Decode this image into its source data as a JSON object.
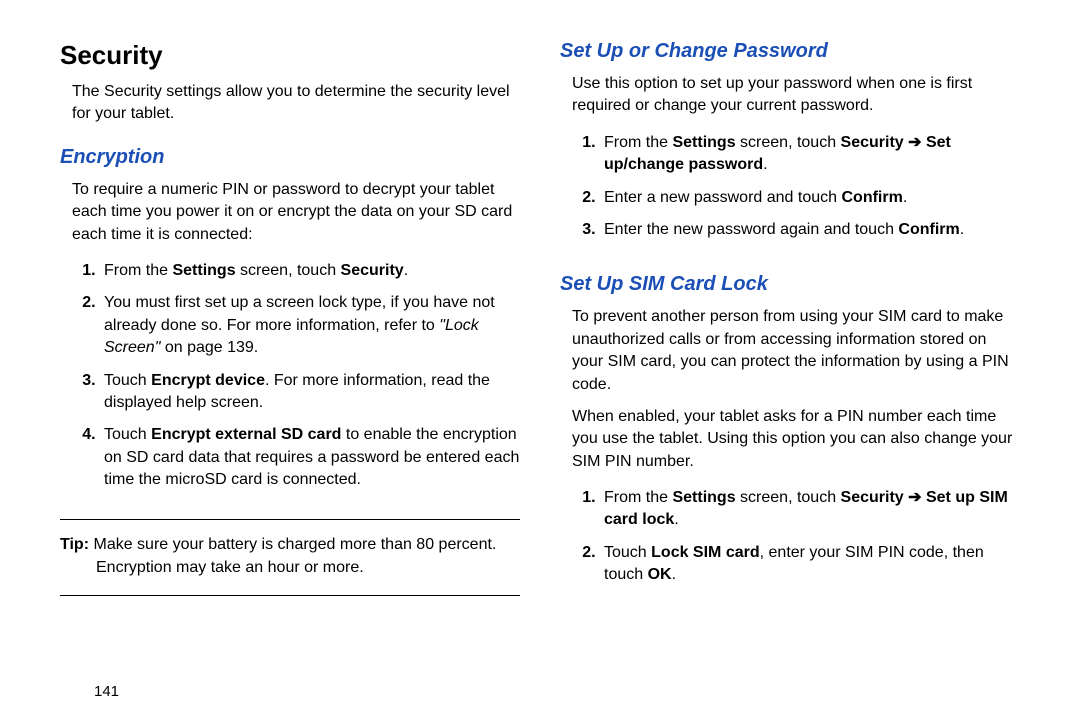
{
  "left": {
    "h1": "Security",
    "intro": "The Security settings allow you to determine the security level for your tablet.",
    "h2_encryption": "Encryption",
    "enc_intro": "To require a numeric PIN or password to decrypt your tablet each time you power it on or encrypt the data on your SD card each time it is connected:",
    "step1_a": "From the ",
    "step1_b": "Settings",
    "step1_c": " screen, touch ",
    "step1_d": "Security",
    "step1_e": ".",
    "step2_a": "You must first set up a screen lock type, if you have not already done so. For more information, refer to ",
    "step2_b": "\"Lock Screen\"",
    "step2_c": " on page 139.",
    "step3_a": "Touch ",
    "step3_b": "Encrypt device",
    "step3_c": ". For more information, read the displayed help screen.",
    "step4_a": "Touch ",
    "step4_b": "Encrypt external SD card",
    "step4_c": " to enable the encryption on SD card data that requires a password be entered each time the microSD card is connected.",
    "tip_label": "Tip: ",
    "tip_body": "Make sure your battery is charged more than 80 percent.",
    "tip_cont": "Encryption may take an hour or more.",
    "pagenum": "141"
  },
  "right": {
    "h2_pw": "Set Up or Change Password",
    "pw_intro": "Use this option to set up your password when one is first required or change your current password.",
    "pw1_a": "From the ",
    "pw1_b": "Settings",
    "pw1_c": " screen, touch ",
    "pw1_d": "Security",
    "pw1_arrow": " ➔ ",
    "pw1_e": "Set up/change password",
    "pw1_f": ".",
    "pw2_a": "Enter a new password and touch ",
    "pw2_b": "Confirm",
    "pw2_c": ".",
    "pw3_a": "Enter the new password again and touch ",
    "pw3_b": "Confirm",
    "pw3_c": ".",
    "h2_sim": "Set Up SIM Card Lock",
    "sim_p1": "To prevent another person from using your SIM card to make unauthorized calls or from accessing information stored on your SIM card, you can protect the information by using a PIN code.",
    "sim_p2": "When enabled, your tablet asks for a PIN number each time you use the tablet. Using this option you can also change your SIM PIN number.",
    "sim1_a": "From the ",
    "sim1_b": "Settings",
    "sim1_c": " screen, touch ",
    "sim1_d": "Security",
    "sim1_arrow": " ➔ ",
    "sim1_e": "Set up SIM card lock",
    "sim1_f": ".",
    "sim2_a": "Touch ",
    "sim2_b": "Lock SIM card",
    "sim2_c": ", enter your SIM PIN code, then touch ",
    "sim2_d": "OK",
    "sim2_e": "."
  }
}
